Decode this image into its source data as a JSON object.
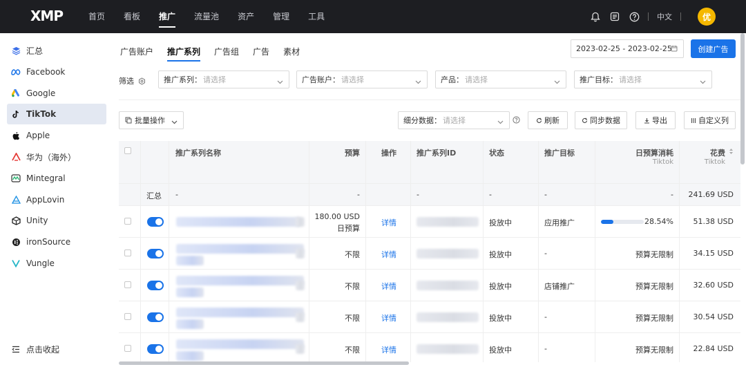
{
  "app": {
    "logo": "XMP"
  },
  "nav": {
    "items": [
      "首页",
      "看板",
      "推广",
      "流量池",
      "资产",
      "管理",
      "工具"
    ],
    "active_index": 2
  },
  "header": {
    "lang": "中文",
    "avatar": "优"
  },
  "sidebar": {
    "items": [
      {
        "label": "汇总",
        "icon": "layers-icon",
        "color": "#3b6fe8"
      },
      {
        "label": "Facebook",
        "icon": "meta-icon",
        "color": "#1a73e8"
      },
      {
        "label": "Google",
        "icon": "google-ads-icon",
        "color": "#fbbc04"
      },
      {
        "label": "TikTok",
        "icon": "tiktok-icon",
        "color": "#111111"
      },
      {
        "label": "Apple",
        "icon": "apple-icon",
        "color": "#111111"
      },
      {
        "label": "华为（海外）",
        "icon": "huawei-icon",
        "color": "#e53935"
      },
      {
        "label": "Mintegral",
        "icon": "mintegral-icon",
        "color": "#2bb673"
      },
      {
        "label": "AppLovin",
        "icon": "applovin-icon",
        "color": "#1a8fe3"
      },
      {
        "label": "Unity",
        "icon": "unity-icon",
        "color": "#222222"
      },
      {
        "label": "ironSource",
        "icon": "ironsource-icon",
        "color": "#222222"
      },
      {
        "label": "Vungle",
        "icon": "vungle-icon",
        "color": "#23b5c7"
      }
    ],
    "active_index": 3,
    "collapse_label": "点击收起"
  },
  "tabs": {
    "items": [
      "广告账户",
      "推广系列",
      "广告组",
      "广告",
      "素材"
    ],
    "active_index": 1
  },
  "date_range": "2023-02-25 - 2023-02-25",
  "create_button": "创建广告",
  "filters": {
    "label": "筛选",
    "items": [
      {
        "label": "推广系列：",
        "placeholder": "请选择"
      },
      {
        "label": "广告账户：",
        "placeholder": "请选择"
      },
      {
        "label": "产品：",
        "placeholder": "请选择"
      },
      {
        "label": "推广目标：",
        "placeholder": "请选择"
      }
    ]
  },
  "toolbar": {
    "batch": "批量操作",
    "detail_label": "细分数据：",
    "detail_placeholder": "请选择",
    "refresh": "刷新",
    "sync": "同步数据",
    "export": "导出",
    "customize": "自定义列"
  },
  "table": {
    "headers": {
      "name": "推广系列名称",
      "budget": "预算",
      "action": "操作",
      "id": "推广系列ID",
      "status": "状态",
      "goal": "推广目标",
      "daily_budget_used": "日预算消耗",
      "daily_budget_used_sub": "Tiktok",
      "spend": "花费",
      "spend_sub": "Tiktok"
    },
    "summary": {
      "label": "汇总",
      "name": "-",
      "budget": "-",
      "id": "-",
      "status": "-",
      "goal": "-",
      "daily": "-",
      "spend": "241.69 USD"
    },
    "rows": [
      {
        "budget": "180.00 USD",
        "budget_sub": "日预算",
        "action": "详情",
        "status": "投放中",
        "goal": "应用推广",
        "daily_pct": 28.54,
        "daily_text": "28.54%",
        "spend": "51.38 USD"
      },
      {
        "budget": "不限",
        "budget_sub": "",
        "action": "详情",
        "status": "投放中",
        "goal": "-",
        "daily_text": "预算无限制",
        "spend": "34.15 USD"
      },
      {
        "budget": "不限",
        "budget_sub": "",
        "action": "详情",
        "status": "投放中",
        "goal": "店铺推广",
        "daily_text": "预算无限制",
        "spend": "32.60 USD"
      },
      {
        "budget": "不限",
        "budget_sub": "",
        "action": "详情",
        "status": "投放中",
        "goal": "-",
        "daily_text": "预算无限制",
        "spend": "30.54 USD"
      },
      {
        "budget": "不限",
        "budget_sub": "",
        "action": "详情",
        "status": "投放中",
        "goal": "-",
        "daily_text": "预算无限制",
        "spend": "22.84 USD"
      }
    ]
  }
}
